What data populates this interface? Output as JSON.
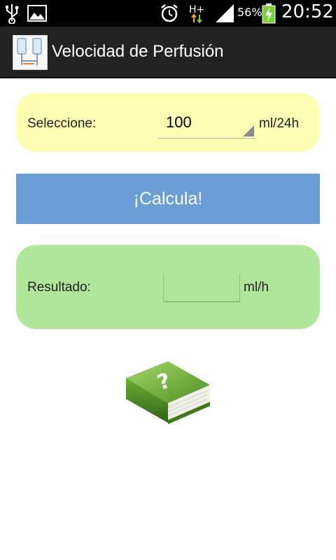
{
  "status_bar": {
    "battery_percent": "56%",
    "time": "20:52",
    "network_type": "H+",
    "icons": [
      "usb-icon",
      "image-icon",
      "alarm-icon",
      "network-hplus-icon",
      "signal-icon",
      "battery-charging-icon"
    ]
  },
  "app_bar": {
    "title": "Velocidad de Perfusión",
    "icon": "iv-drip-icon"
  },
  "selector": {
    "label": "Seleccione:",
    "value": "100",
    "unit": "ml/24h"
  },
  "calculate_button": {
    "label": "¡Calcula!"
  },
  "result": {
    "label": "Resultado:",
    "value": "",
    "unit": "ml/h"
  },
  "help": {
    "icon": "help-book-icon"
  },
  "colors": {
    "status_bar": "#000000",
    "action_bar": "#222222",
    "select_panel": "#fefdb3",
    "button": "#6b9ed6",
    "result_panel": "#b0e69a"
  }
}
